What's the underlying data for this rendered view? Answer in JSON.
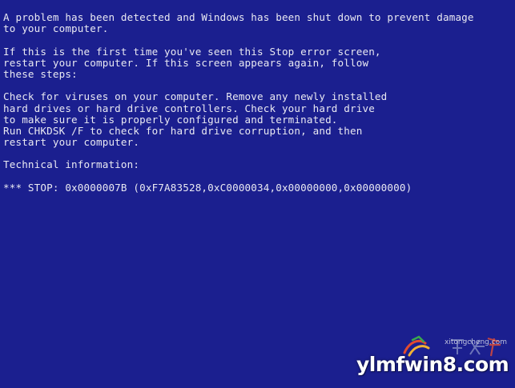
{
  "screen": {
    "background": "#1b1f8f",
    "text_color": "#e9e9f2",
    "paragraph1": [
      "A problem has been detected and Windows has been shut down to prevent damage",
      "to your computer."
    ],
    "paragraph2": [
      "If this is the first time you've seen this Stop error screen,",
      "restart your computer. If this screen appears again, follow",
      "these steps:"
    ],
    "paragraph3": [
      "Check for viruses on your computer. Remove any newly installed",
      "hard drives or hard drive controllers. Check your hard drive",
      "to make sure it is properly configured and terminated.",
      "Run CHKDSK /F to check for hard drive corruption, and then",
      "restart your computer."
    ],
    "technical_heading": "Technical information:",
    "stop_code": "*** STOP: 0x0000007B (0xF7A83528,0xC0000034,0x00000000,0x00000000)"
  },
  "watermark": {
    "main_text": "ylmfwin8.com",
    "sub_text": "xitongcheng.com",
    "icon": "windows-logo-icon"
  }
}
